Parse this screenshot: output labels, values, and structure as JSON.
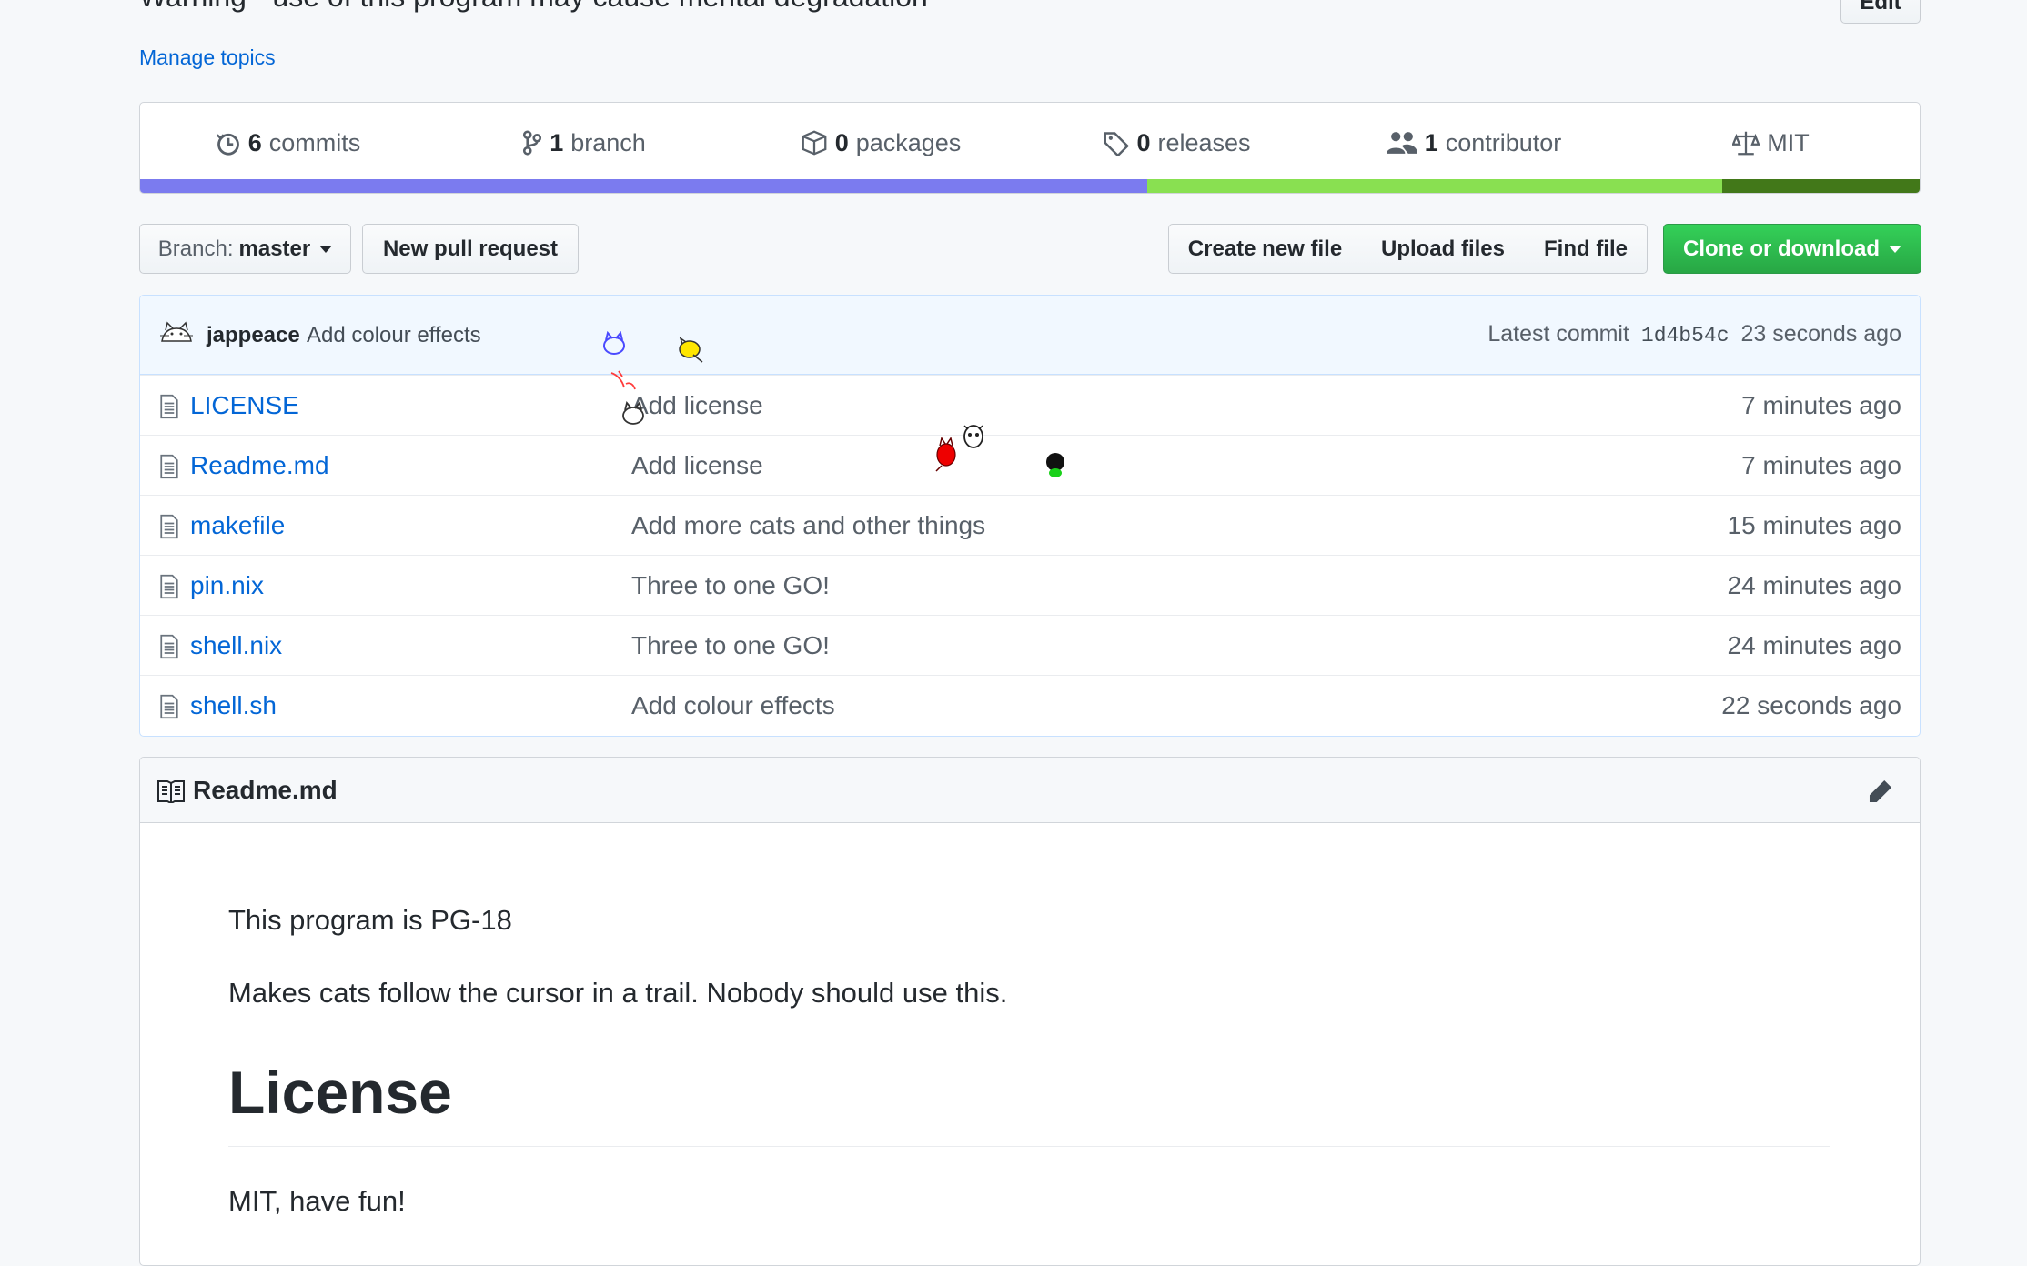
{
  "repo": {
    "description": "Warning - use of this program may cause mental degradation",
    "edit_label": "Edit",
    "manage_topics": "Manage topics"
  },
  "summary": {
    "commits": {
      "count": "6",
      "label": "commits"
    },
    "branches": {
      "count": "1",
      "label": "branch"
    },
    "packages": {
      "count": "0",
      "label": "packages"
    },
    "releases": {
      "count": "0",
      "label": "releases"
    },
    "contributors": {
      "count": "1",
      "label": "contributor"
    },
    "license": "MIT",
    "language_colors": [
      "#7b7bef",
      "#89e051",
      "#427819"
    ]
  },
  "toolbar": {
    "branch_prefix": "Branch:",
    "branch_name": "master",
    "new_pr": "New pull request",
    "create_file": "Create new file",
    "upload_files": "Upload files",
    "find_file": "Find file",
    "clone": "Clone or download"
  },
  "latest_commit": {
    "author": "jappeace",
    "message": "Add colour effects",
    "label": "Latest commit",
    "sha": "1d4b54c",
    "age": "23 seconds ago"
  },
  "files": [
    {
      "name": "LICENSE",
      "message": "Add license",
      "age": "7 minutes ago"
    },
    {
      "name": "Readme.md",
      "message": "Add license",
      "age": "7 minutes ago"
    },
    {
      "name": "makefile",
      "message": "Add more cats and other things",
      "age": "15 minutes ago"
    },
    {
      "name": "pin.nix",
      "message": "Three to one GO!",
      "age": "24 minutes ago"
    },
    {
      "name": "shell.nix",
      "message": "Three to one GO!",
      "age": "24 minutes ago"
    },
    {
      "name": "shell.sh",
      "message": "Add colour effects",
      "age": "22 seconds ago"
    }
  ],
  "readme": {
    "title": "Readme.md",
    "p1": "This program is PG-18",
    "p2": "Makes cats follow the cursor in a trail. Nobody should use this.",
    "h1": "License",
    "p3": "MIT, have fun!"
  },
  "icons": {
    "commits": "history-icon",
    "branch": "git-branch-icon",
    "packages": "package-icon",
    "releases": "tag-icon",
    "contributors": "people-icon",
    "license": "law-icon",
    "file": "file-icon",
    "readme": "book-icon",
    "edit": "pencil-icon"
  }
}
